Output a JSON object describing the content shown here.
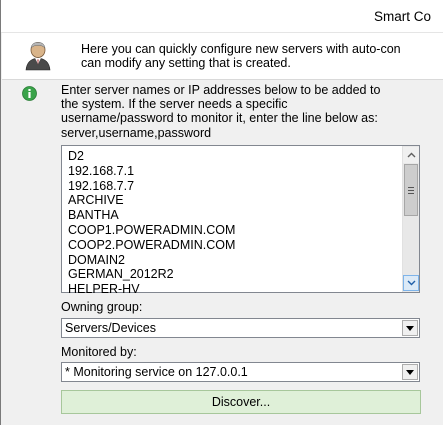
{
  "window": {
    "title": "Smart Co"
  },
  "header": {
    "intro_line1": "Here you can quickly configure new servers with auto-con",
    "intro_line2": "can modify any setting that is created."
  },
  "instructions": {
    "lines": [
      "Enter server names or IP addresses below to be added to",
      "the system.  If the server needs a specific",
      "username/password to monitor it, enter the line below as:",
      "server,username,password"
    ]
  },
  "server_list": {
    "items": [
      "D2",
      "192.168.7.1",
      "192.168.7.7",
      "ARCHIVE",
      "BANTHA",
      "COOP1.POWERADMIN.COM",
      "COOP2.POWERADMIN.COM",
      "DOMAIN2",
      "GERMAN_2012R2",
      "HELPER-HV"
    ]
  },
  "owning_group": {
    "label": "Owning group:",
    "value": "Servers/Devices"
  },
  "monitored_by": {
    "label": "Monitored by:",
    "value": "* Monitoring service on 127.0.0.1"
  },
  "discover_button": {
    "label": "Discover..."
  },
  "icons": {
    "avatar": "user-avatar-icon",
    "info": "green-info-icon"
  },
  "colors": {
    "discover_bg": "#dff0d8",
    "info_green": "#3aa34a"
  }
}
